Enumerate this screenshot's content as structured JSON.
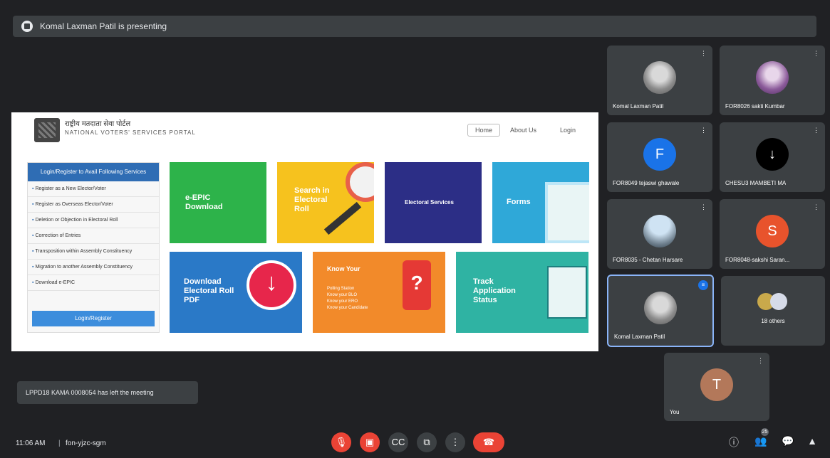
{
  "banner": {
    "text": "Komal Laxman Patil is presenting"
  },
  "portal": {
    "title_hi": "राष्ट्रीय मतदाता सेवा पोर्टल",
    "title_en": "NATIONAL VOTERS' SERVICES PORTAL",
    "nav": [
      "Home",
      "About Us",
      "Login"
    ],
    "left_panel": {
      "heading": "Login/Register to Avail Following Services",
      "items": [
        "Register as a New Elector/Voter",
        "Register as Overseas Elector/Voter",
        "Deletion or Objection in Electoral Roll",
        "Correction of Entries",
        "Transposition within Assembly Constituency",
        "Migration to another Assembly Constituency",
        "Download e-EPIC"
      ],
      "button": "Login/Register"
    },
    "tiles": [
      {
        "label": "e-EPIC Download"
      },
      {
        "label": "Search in Electoral Roll"
      },
      {
        "label": "Electoral Services"
      },
      {
        "label": "Forms"
      },
      {
        "label": "Download Electoral Roll PDF"
      },
      {
        "label": "Know Your",
        "lines": [
          "Polling Station",
          "Know your BLO",
          "Know your ERO",
          "Know your Candidate"
        ]
      },
      {
        "label": "Track Application Status"
      }
    ]
  },
  "participants": [
    {
      "name": "Komal Laxman Patil",
      "initial": "",
      "style": "photo",
      "color": ""
    },
    {
      "name": "FOR8026 sakti Kumbar",
      "initial": "",
      "style": "purple",
      "color": ""
    },
    {
      "name": "FOR8049 tejaswi ghawale",
      "initial": "F",
      "style": "letter",
      "color": "#1a73e8"
    },
    {
      "name": "CHESU3 MAMBETI  MA",
      "initial": "",
      "style": "dark",
      "color": "#000000"
    },
    {
      "name": "FOR8035 - Chetan Harsare",
      "initial": "",
      "style": "land",
      "color": ""
    },
    {
      "name": "FOR8048-sakshi Saran...",
      "initial": "S",
      "style": "letter",
      "color": "#e8532c"
    },
    {
      "name": "Komal Laxman Patil",
      "initial": "",
      "style": "photo",
      "color": ""
    },
    {
      "name": "",
      "initial": "",
      "style": "others",
      "color": ""
    },
    {
      "name": "You",
      "initial": "T",
      "style": "letter",
      "color": "#b3785a"
    }
  ],
  "others_label": "18 others",
  "toast": {
    "text": "LPPD18 KAMA 0008054 has left the meeting"
  },
  "bottom": {
    "time": "11:06 AM",
    "separator": "|",
    "meeting_code": "fon-yjzc-sgm",
    "people_badge": "25"
  },
  "icons": {
    "mic": "mic-off-icon",
    "cam": "camera-off-icon",
    "cc": "captions-icon",
    "present": "present-icon",
    "more": "more-icon",
    "hangup": "hangup-icon",
    "info": "info-icon",
    "people": "people-icon",
    "chat": "chat-icon",
    "activities": "activities-icon"
  }
}
